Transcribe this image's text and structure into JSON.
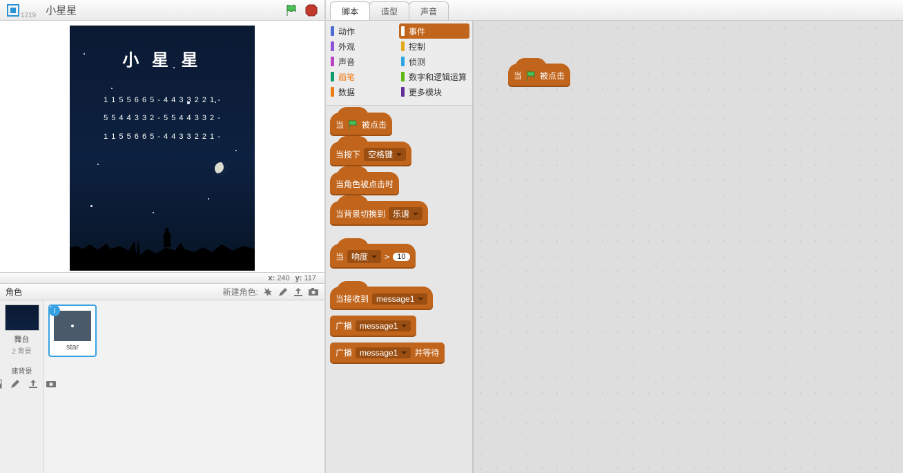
{
  "header": {
    "project_id": "1219",
    "title": "小星星"
  },
  "stage": {
    "title": "小 星 星",
    "note_line1": "1 1 5 5 6 6 5 -  4 4 3 3 2 2 1 -",
    "note_line2": "5 5 4 4 3 3 2 -  5 5 4 4 3 3 2 -",
    "note_line3": "1 1 5 5 6 6 5 -  4 4 3 3 2 2 1 -"
  },
  "coords": {
    "x_label": "x:",
    "x": "240",
    "y_label": "y:",
    "y": "117"
  },
  "sprite_panel": {
    "label": "角色",
    "new_label": "新建角色:",
    "stage_label": "舞台",
    "stage_sub": "2 背景",
    "new_bg_label": "建背景",
    "sprite0": {
      "name": "star",
      "info": "i"
    }
  },
  "tabs": {
    "scripts": "脚本",
    "costumes": "造型",
    "sounds": "声音"
  },
  "categories": {
    "motion": "动作",
    "looks": "外观",
    "sound": "声音",
    "pen": "画笔",
    "data": "数据",
    "events": "事件",
    "control": "控制",
    "sensing": "侦测",
    "operators": "数字和逻辑运算",
    "more": "更多模块"
  },
  "category_colors": {
    "motion": "#4a6cd4",
    "looks": "#8a55d7",
    "sound": "#bb42c3",
    "pen": "#0e9a6c",
    "data": "#ee7d16",
    "events": "#c88330",
    "control": "#e1a91a",
    "sensing": "#2ca5e2",
    "operators": "#5cb712",
    "more": "#632d99"
  },
  "blocks": {
    "when_flag": {
      "pre": "当",
      "post": "被点击"
    },
    "when_key": {
      "pre": "当按下",
      "dd": "空格键"
    },
    "when_clicked": {
      "text": "当角色被点击时"
    },
    "when_backdrop": {
      "pre": "当背景切换到",
      "dd": "乐谱"
    },
    "when_loud": {
      "pre": "当",
      "dd": "响度",
      "gt": ">",
      "num": "10"
    },
    "when_receive": {
      "pre": "当接收到",
      "dd": "message1"
    },
    "broadcast": {
      "pre": "广播",
      "dd": "message1"
    },
    "broadcast_wait": {
      "pre": "广播",
      "dd": "message1",
      "post": "并等待"
    }
  },
  "placed_block": {
    "pre": "当",
    "post": "被点击"
  }
}
